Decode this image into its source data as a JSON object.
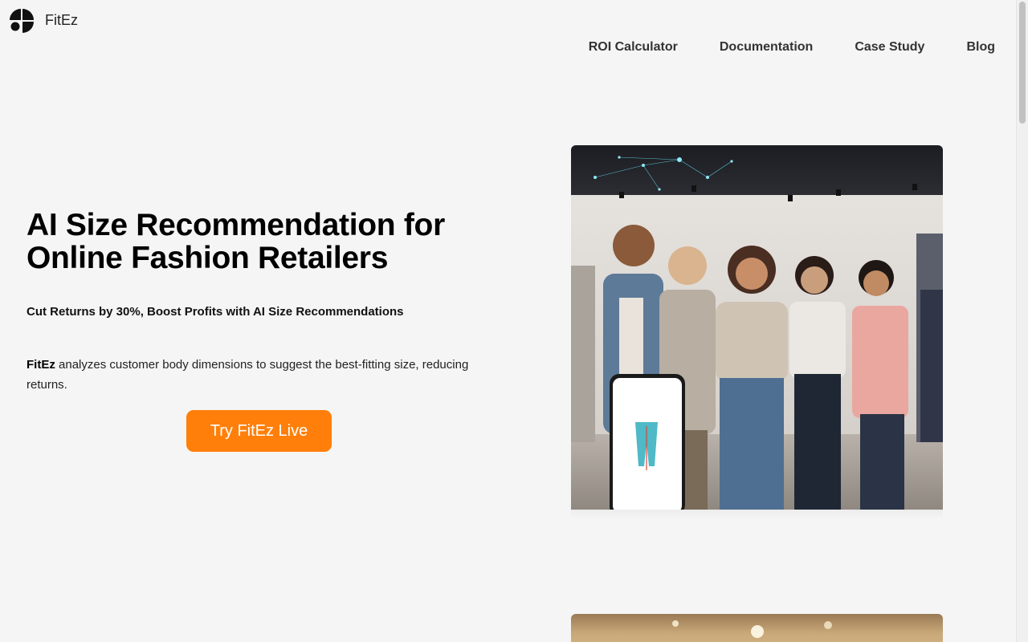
{
  "brand": {
    "name": "FitEz",
    "logo_icon": "fitez-logo-icon"
  },
  "nav": {
    "items": [
      {
        "label": "ROI Calculator"
      },
      {
        "label": "Documentation"
      },
      {
        "label": "Case Study"
      },
      {
        "label": "Blog"
      }
    ]
  },
  "hero": {
    "title": "AI Size Recommendation for Online Fashion Retailers",
    "subtitle": "Cut Returns by 30%, Boost Profits with AI Size Recommendations",
    "description_brand": "FitEz",
    "description_rest": " analyzes customer body dimensions to suggest the best-fitting size, reducing returns.",
    "cta_label": "Try FitEz Live",
    "cta_color": "#ff7f0a",
    "image_icon": "group-of-shoppers-with-phone-photo"
  },
  "second_section": {
    "image_icon": "store-interior-photo"
  },
  "colors": {
    "background": "#f5f5f5",
    "accent": "#ff7f0a",
    "text": "#111111"
  }
}
